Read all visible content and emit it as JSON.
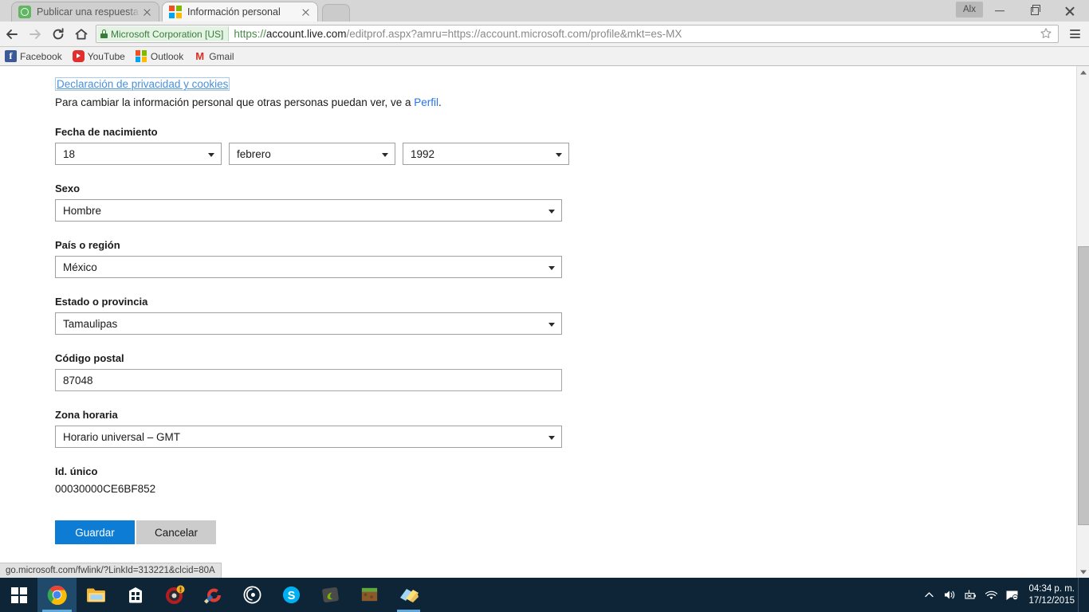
{
  "browser": {
    "tabs": [
      {
        "title": "Publicar una respuesta - X",
        "favicon": "xbox-icon",
        "active": false
      },
      {
        "title": "Información personal",
        "favicon": "microsoft-icon",
        "active": true
      }
    ],
    "window_controls": {
      "profile_chip": "Alx",
      "minimize": "minimize-icon",
      "maximize": "maximize-icon",
      "close": "close-icon"
    },
    "toolbar": {
      "back": "back-arrow-icon",
      "forward": "forward-arrow-icon",
      "reload": "reload-icon",
      "home": "home-icon",
      "security_badge": "Microsoft Corporation [US]",
      "url_scheme": "https://",
      "url_host": "account.live.com",
      "url_path": "/editprof.aspx?amru=https://account.microsoft.com/profile&mkt=es-MX",
      "bookmark_star": "star-icon",
      "menu": "hamburger-menu-icon"
    },
    "bookmarks": [
      {
        "label": "Facebook",
        "icon": "facebook-icon"
      },
      {
        "label": "YouTube",
        "icon": "youtube-icon"
      },
      {
        "label": "Outlook",
        "icon": "outlook-icon"
      },
      {
        "label": "Gmail",
        "icon": "gmail-icon"
      }
    ],
    "status_text": "go.microsoft.com/fwlink/?LinkId=313221&clcid=80A"
  },
  "page": {
    "privacy_link": "Declaración de privacidad y cookies",
    "intro_before": "Para cambiar la información personal que otras personas puedan ver, ve a ",
    "intro_link": "Perfil",
    "intro_after": ".",
    "fields": {
      "birthdate": {
        "label": "Fecha de nacimiento",
        "day": "18",
        "month": "febrero",
        "year": "1992"
      },
      "gender": {
        "label": "Sexo",
        "value": "Hombre"
      },
      "country": {
        "label": "País o región",
        "value": "México"
      },
      "state": {
        "label": "Estado o provincia",
        "value": "Tamaulipas"
      },
      "postal": {
        "label": "Código postal",
        "value": "87048"
      },
      "timezone": {
        "label": "Zona horaria",
        "value": "Horario universal – GMT"
      },
      "unique_id": {
        "label": "Id. único",
        "value": "00030000CE6BF852"
      }
    },
    "buttons": {
      "save": "Guardar",
      "cancel": "Cancelar"
    }
  },
  "taskbar": {
    "start": "windows-start-icon",
    "items": [
      {
        "name": "chrome-icon"
      },
      {
        "name": "file-explorer-icon"
      },
      {
        "name": "microsoft-store-icon"
      },
      {
        "name": "game-app-icon"
      },
      {
        "name": "ccleaner-icon"
      },
      {
        "name": "circle-app-icon"
      },
      {
        "name": "skype-icon"
      },
      {
        "name": "nvidia-icon"
      },
      {
        "name": "minecraft-icon"
      },
      {
        "name": "sticky-notes-icon"
      }
    ],
    "tray": [
      {
        "name": "show-hidden-icons-chevron"
      },
      {
        "name": "volume-icon"
      },
      {
        "name": "battery-icon"
      },
      {
        "name": "wifi-icon"
      },
      {
        "name": "action-center-icon"
      }
    ],
    "clock_time": "04:34 p. m.",
    "clock_date": "17/12/2015"
  },
  "colors": {
    "accent_blue": "#0c7cd5",
    "link_blue": "#2672ec",
    "secure_green": "#3a7d3a",
    "taskbar": "#0d2537"
  }
}
